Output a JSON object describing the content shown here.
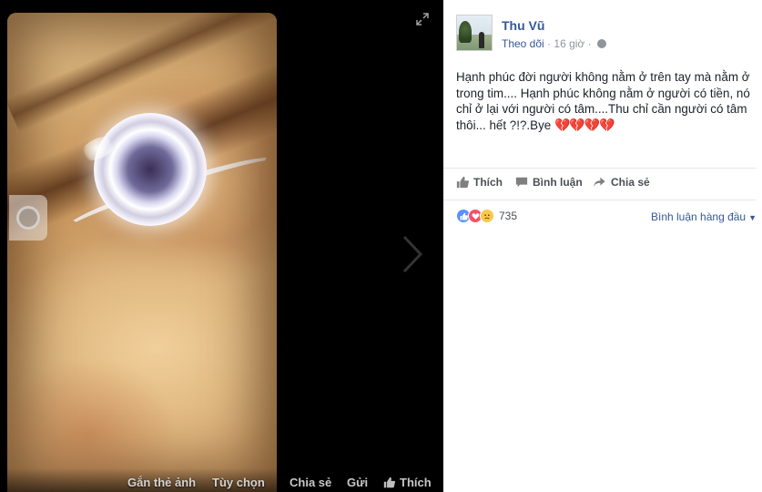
{
  "photo_viewer": {
    "expand_icon": "expand-icon",
    "next_icon": "chevron-right-icon",
    "bottom_bar": {
      "tag_photo": "Gắn thẻ ảnh",
      "options": "Tùy chọn",
      "share": "Chia sẻ",
      "send": "Gửi",
      "like": "Thích"
    }
  },
  "post": {
    "author": "Thu Vũ",
    "follow": "Theo dõi",
    "time": "16 giờ",
    "privacy_icon": "globe-icon",
    "text": "Hạnh phúc đời người không nằm ở trên tay mà nằm ở trong tim.... Hạnh phúc không nằm ở người có tiền, nó chỉ ở lại với người có tâm....Thu chỉ cần người có tâm thôi... hết ?!?.Bye",
    "hearts": "💔💔💔💔",
    "actions": {
      "like": "Thích",
      "comment": "Bình luận",
      "share": "Chia sẻ"
    },
    "reactions": {
      "types": [
        "like",
        "love",
        "sad"
      ],
      "count": "735"
    },
    "comment_sort": "Bình luận hàng đầu"
  },
  "colors": {
    "link_blue": "#365899",
    "text": "#1d2129",
    "muted": "#90949c",
    "like": "#5890ff",
    "love": "#f25268"
  }
}
